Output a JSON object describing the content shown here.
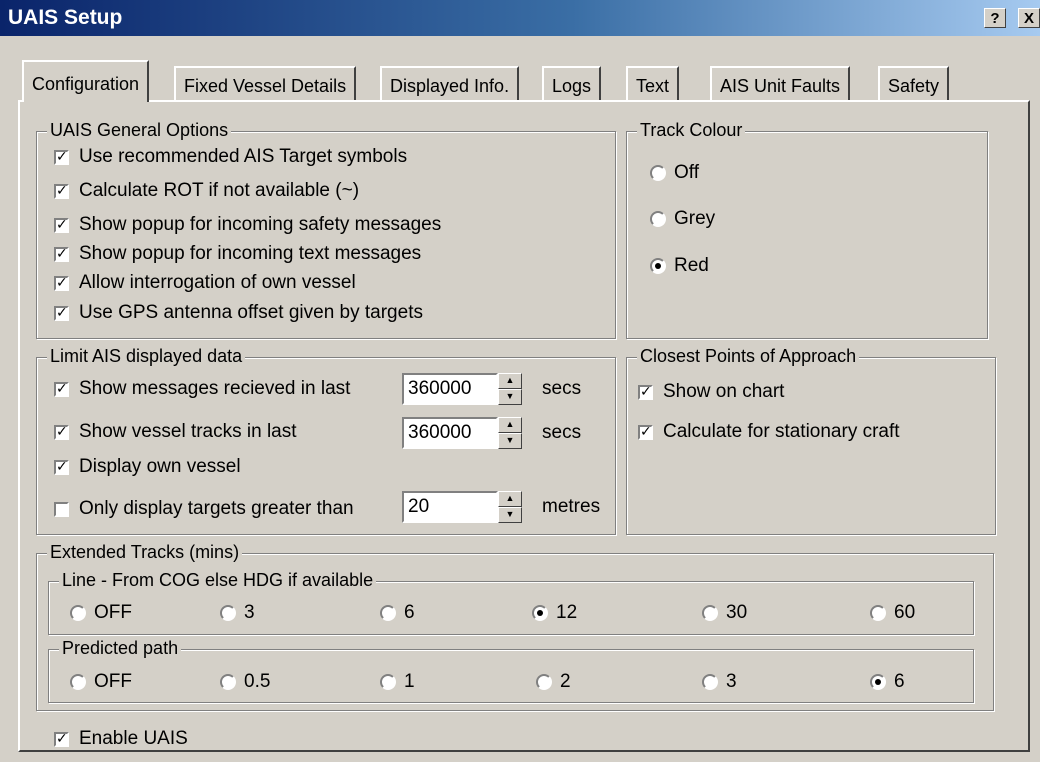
{
  "window": {
    "title": "UAIS Setup",
    "help_label": "?",
    "close_label": "X"
  },
  "tabs": [
    "Configuration",
    "Fixed Vessel Details",
    "Displayed Info.",
    "Logs",
    "Text",
    "AIS Unit Faults",
    "Safety"
  ],
  "general": {
    "title": "UAIS General Options",
    "options": [
      {
        "label": "Use recommended AIS Target symbols",
        "checked": true
      },
      {
        "label": "Calculate ROT if not available (~)",
        "checked": true
      },
      {
        "label": "Show popup for incoming safety messages",
        "checked": true
      },
      {
        "label": "Show popup for incoming text messages",
        "checked": true
      },
      {
        "label": "Allow interrogation of own vessel",
        "checked": true
      },
      {
        "label": "Use GPS antenna offset given by targets",
        "checked": true
      }
    ]
  },
  "track_colour": {
    "title": "Track Colour",
    "options": [
      {
        "label": "Off",
        "selected": false
      },
      {
        "label": "Grey",
        "selected": false
      },
      {
        "label": "Red",
        "selected": true
      }
    ]
  },
  "limit": {
    "title": "Limit AIS displayed data",
    "messages": {
      "label": "Show messages recieved in last",
      "checked": true,
      "value": "360000",
      "unit": "secs"
    },
    "tracks": {
      "label": "Show vessel tracks in last",
      "checked": true,
      "value": "360000",
      "unit": "secs"
    },
    "own_vessel": {
      "label": "Display own vessel",
      "checked": true
    },
    "targets": {
      "label": "Only display targets greater than",
      "checked": false,
      "value": "20",
      "unit": "metres"
    }
  },
  "cpa": {
    "title": "Closest Points of Approach",
    "show_on_chart": {
      "label": "Show on chart",
      "checked": true
    },
    "stationary": {
      "label": "Calculate for stationary craft",
      "checked": true
    }
  },
  "extended": {
    "title": "Extended Tracks (mins)",
    "line": {
      "title": "Line - From COG else HDG if available",
      "options": [
        "OFF",
        "3",
        "6",
        "12",
        "30",
        "60"
      ],
      "selected": "12"
    },
    "predicted": {
      "title": "Predicted path",
      "options": [
        "OFF",
        "0.5",
        "1",
        "2",
        "3",
        "6"
      ],
      "selected": "6"
    }
  },
  "enable": {
    "label": "Enable UAIS",
    "checked": true
  }
}
